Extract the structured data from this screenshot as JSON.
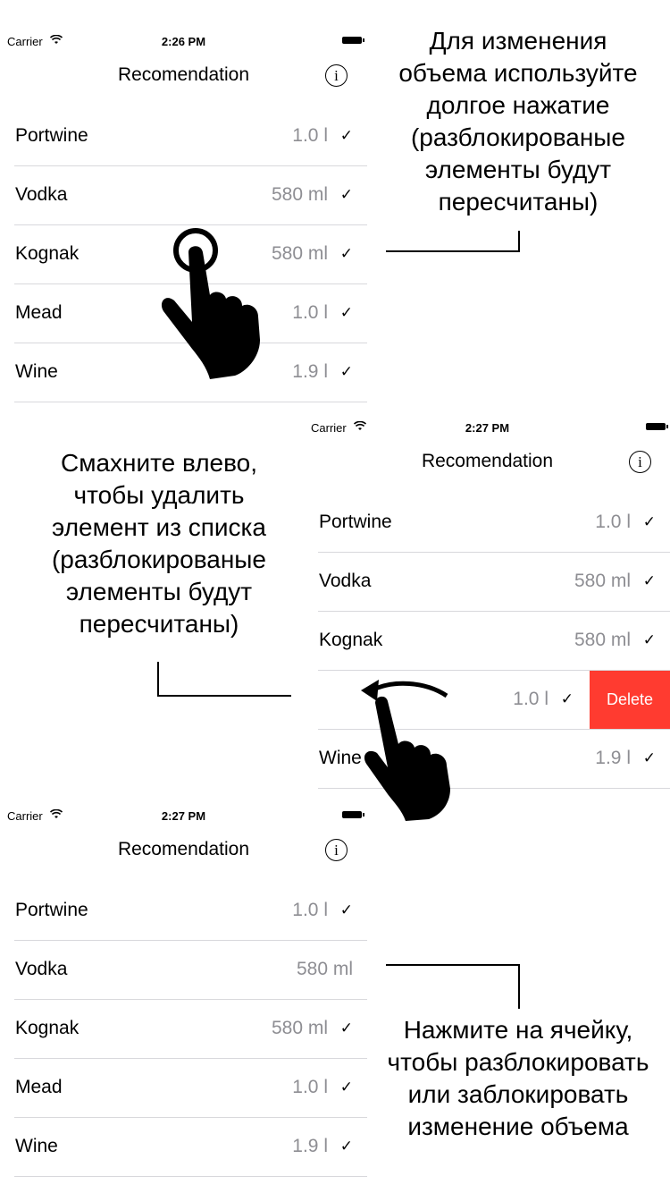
{
  "screens": [
    {
      "status": {
        "carrier": "Carrier",
        "time": "2:26 PM"
      },
      "title": "Recomendation",
      "info_icon": "i",
      "rows": [
        {
          "name": "Portwine",
          "volume": "1.0 l",
          "checked": true
        },
        {
          "name": "Vodka",
          "volume": "580 ml",
          "checked": true
        },
        {
          "name": "Kognak",
          "volume": "580 ml",
          "checked": true
        },
        {
          "name": "Mead",
          "volume": "1.0 l",
          "checked": true
        },
        {
          "name": "Wine",
          "volume": "1.9 l",
          "checked": true
        }
      ]
    },
    {
      "status": {
        "carrier": "Carrier",
        "time": "2:27 PM"
      },
      "title": "Recomendation",
      "info_icon": "i",
      "rows": [
        {
          "name": "Portwine",
          "volume": "1.0 l",
          "checked": true
        },
        {
          "name": "Vodka",
          "volume": "580 ml",
          "checked": true
        },
        {
          "name": "Kognak",
          "volume": "580 ml",
          "checked": true
        },
        {
          "name": "",
          "volume": "1.0 l",
          "checked": true,
          "delete_label": "Delete"
        },
        {
          "name": "Wine",
          "volume": "1.9 l",
          "checked": true
        }
      ]
    },
    {
      "status": {
        "carrier": "Carrier",
        "time": "2:27 PM"
      },
      "title": "Recomendation",
      "info_icon": "i",
      "rows": [
        {
          "name": "Portwine",
          "volume": "1.0 l",
          "checked": true
        },
        {
          "name": "Vodka",
          "volume": "580 ml",
          "checked": false
        },
        {
          "name": "Kognak",
          "volume": "580 ml",
          "checked": true
        },
        {
          "name": "Mead",
          "volume": "1.0 l",
          "checked": true
        },
        {
          "name": "Wine",
          "volume": "1.9 l",
          "checked": true
        }
      ]
    }
  ],
  "check_glyph": "✓",
  "callouts": {
    "long_press": [
      "Для изменения",
      "объема используйте",
      "долгое нажатие",
      "(разблокированые",
      "элементы будут",
      "пересчитаны)"
    ],
    "swipe": [
      "Смахните влево,",
      "чтобы удалить",
      "элемент из списка",
      "(разблокированые",
      "элементы будут",
      "пересчитаны)"
    ],
    "tap": [
      "Нажмите на ячейку,",
      "чтобы разблокировать",
      "или заблокировать",
      "изменение объема"
    ]
  },
  "icons": {
    "wifi": "wifi-icon",
    "battery": "battery-icon",
    "info": "info-icon",
    "hand_tap": "hand-tap-icon",
    "hand_swipe": "hand-swipe-icon"
  }
}
